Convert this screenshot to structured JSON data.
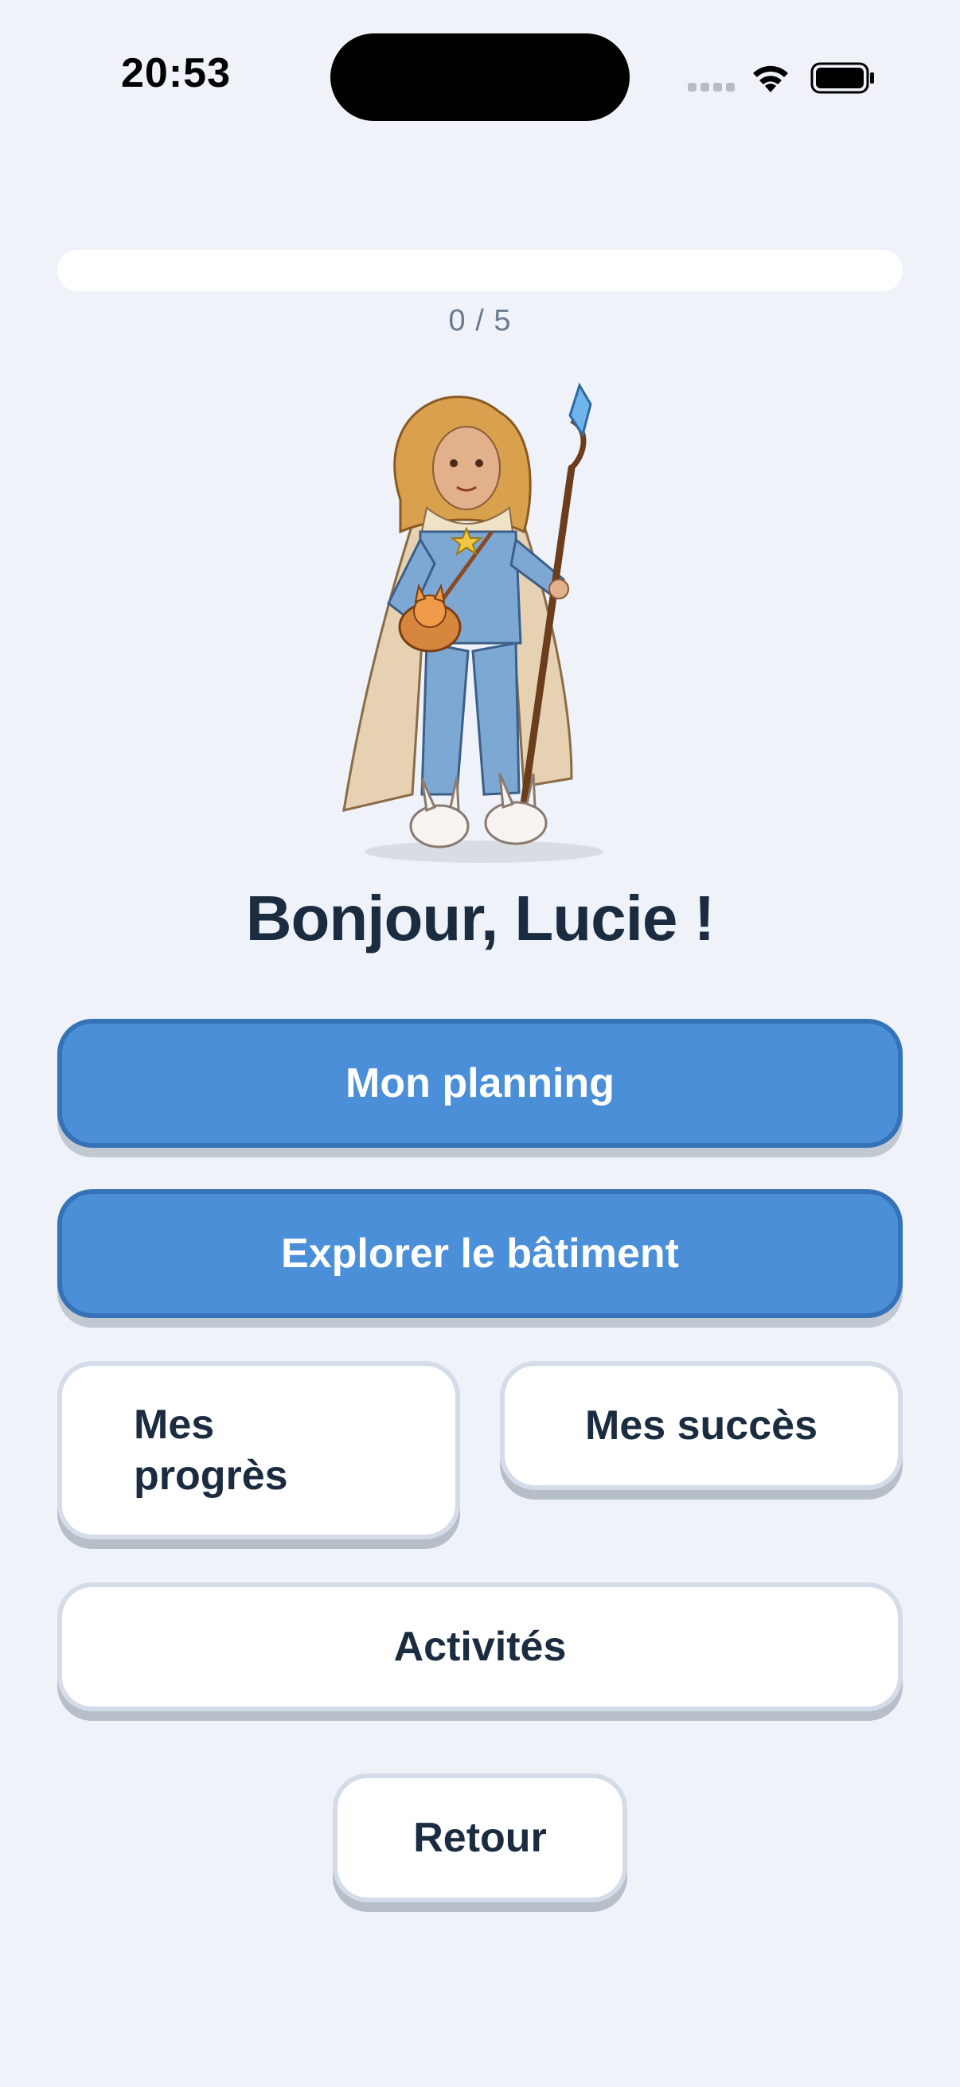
{
  "status_bar": {
    "time": "20:53"
  },
  "progress": {
    "label": "0 / 5",
    "completed": 0,
    "total": 5
  },
  "greeting": "Bonjour, Lucie !",
  "buttons": {
    "planning": "Mon planning",
    "explore": "Explorer le bâtiment",
    "progress": "Mes progrès",
    "success": "Mes succès",
    "activities": "Activités",
    "back": "Retour"
  },
  "colors": {
    "background": "#eff3f9",
    "primary": "#4a8fd8",
    "primary_border": "#3572b8",
    "text_dark": "#1b2b40"
  },
  "icons": [
    "cellular-signal-icon",
    "wifi-icon",
    "battery-icon"
  ]
}
